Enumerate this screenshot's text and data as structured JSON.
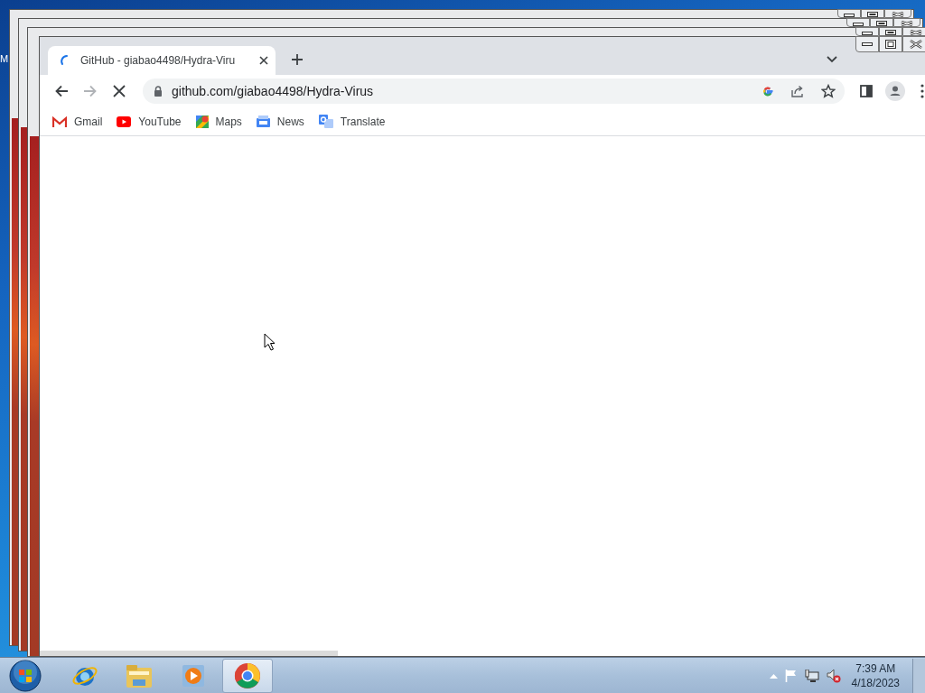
{
  "desktop": {
    "edge_text": "M"
  },
  "background_windows": [
    {
      "kind": "blank"
    },
    {
      "kind": "blank"
    },
    {
      "kind": "blank"
    }
  ],
  "browser": {
    "tabs": [
      {
        "title": "GitHub - giabao4498/Hydra-Viru",
        "selected": true,
        "loading": true
      }
    ],
    "forward_disabled": true,
    "loading": true,
    "address": "github.com/giabao4498/Hydra-Virus",
    "bookmarks": [
      {
        "label": "Gmail",
        "kind": "gmail"
      },
      {
        "label": "YouTube",
        "kind": "youtube"
      },
      {
        "label": "Maps",
        "kind": "maps"
      },
      {
        "label": "News",
        "kind": "news"
      },
      {
        "label": "Translate",
        "kind": "translate"
      }
    ]
  },
  "taskbar": {
    "apps": [
      {
        "kind": "ie",
        "selected": false
      },
      {
        "kind": "explorer",
        "selected": false
      },
      {
        "kind": "media",
        "selected": false
      },
      {
        "kind": "chrome",
        "selected": true
      }
    ],
    "volume_muted": true,
    "time": "7:39 AM",
    "date": "4/18/2023"
  }
}
